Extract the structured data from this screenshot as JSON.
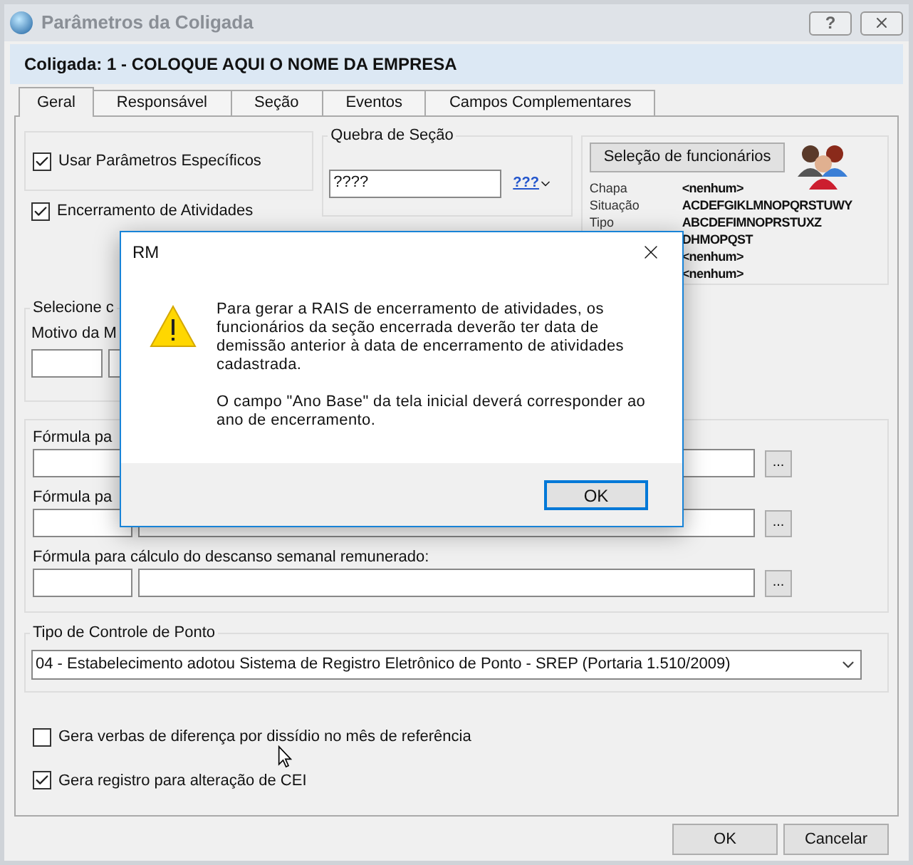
{
  "window": {
    "title": "Parâmetros da Coligada",
    "help": "?"
  },
  "header": "Coligada: 1 - COLOQUE AQUI O NOME DA EMPRESA",
  "tabs": [
    {
      "label": "Geral",
      "selected": true
    },
    {
      "label": "Responsável",
      "selected": false
    },
    {
      "label": "Seção",
      "selected": false
    },
    {
      "label": "Eventos",
      "selected": false
    },
    {
      "label": "Campos Complementares",
      "selected": false
    }
  ],
  "options": [
    {
      "label": "Usar Parâmetros Específicos",
      "checked": true
    },
    {
      "label": "Encerramento de Atividades",
      "checked": true
    }
  ],
  "quebra_de_secao": {
    "legend": "Quebra de Seção",
    "value": "????",
    "macro": "???"
  },
  "selection": {
    "button": "Seleção de funcionários",
    "rows": [
      {
        "label": "Chapa",
        "value": "<nenhum>"
      },
      {
        "label": "Situação",
        "value": "ACDEFGIKLMNOPQRSTUWY"
      },
      {
        "label": "Tipo",
        "value": "ABCDEFIMNOPRSTUXZ"
      },
      {
        "value": "DHMOPQST"
      },
      {
        "value": "<nenhum>"
      },
      {
        "value": "<nenhum>"
      }
    ]
  },
  "selecione_group": {
    "legend": "Selecione c",
    "label": "Motivo da M"
  },
  "formulas": [
    {
      "label": "Fórmula pa",
      "button": "..."
    },
    {
      "label": "Fórmula pa",
      "button": "..."
    },
    {
      "label": "Fórmula para cálculo do descanso semanal remunerado:",
      "button": "..."
    }
  ],
  "tipo_controle": {
    "legend": "Tipo de Controle de Ponto",
    "value": "04 - Estabelecimento adotou Sistema de Registro Eletrônico de Ponto - SREP (Portaria 1.510/2009)"
  },
  "flags": [
    {
      "label": "Gera verbas de diferença por dissídio no mês de referência",
      "checked": false
    },
    {
      "label": "Gera registro para alteração de CEI",
      "checked": true
    }
  ],
  "buttons": [
    "OK",
    "Cancelar"
  ],
  "dialog": {
    "title": "RM",
    "paragraphs": [
      "Para gerar a RAIS de encerramento de atividades, os funcionários da seção encerrada deverão ter data de demissão anterior à data de encerramento de atividades cadastrada.",
      "O campo \"Ano Base\" da tela inicial deverá corresponder ao ano de encerramento."
    ],
    "button": "OK"
  }
}
